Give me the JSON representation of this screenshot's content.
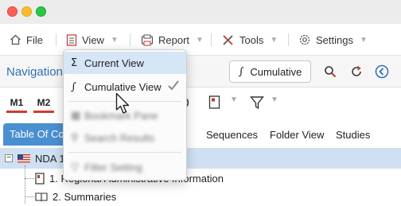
{
  "menubar": {
    "file_label": "File",
    "view_label": "View",
    "report_label": "Report",
    "tools_label": "Tools",
    "settings_label": "Settings"
  },
  "navbar": {
    "title": "Navigation",
    "cumulative_button_label": "Cumulative"
  },
  "modules": [
    "M1",
    "M2"
  ],
  "tabs": {
    "active": "Table Of Contents",
    "others": [
      "Sequences",
      "Folder View",
      "Studies"
    ]
  },
  "tree": {
    "root_label": "NDA 1",
    "items": [
      "1. Regional Administrative Information",
      "2. Summaries"
    ]
  },
  "view_menu": {
    "items": [
      {
        "label": "Current View",
        "icon": "sigma-icon"
      },
      {
        "label": "Cumulative View",
        "icon": "integral-icon",
        "checked": true
      },
      {
        "label": "Bookmark Pane",
        "icon": "bookmark-icon",
        "disabled": true
      },
      {
        "label": "Search Results",
        "icon": "search-icon",
        "disabled": true
      },
      {
        "label": "Filter Setting",
        "icon": "filter-icon",
        "disabled": true
      }
    ]
  },
  "colors": {
    "accent": "#2e6fb7",
    "tab_active": "#4a8fd0",
    "menu_highlight": "#d6e6f6",
    "module_underline": "#d23a2f"
  }
}
